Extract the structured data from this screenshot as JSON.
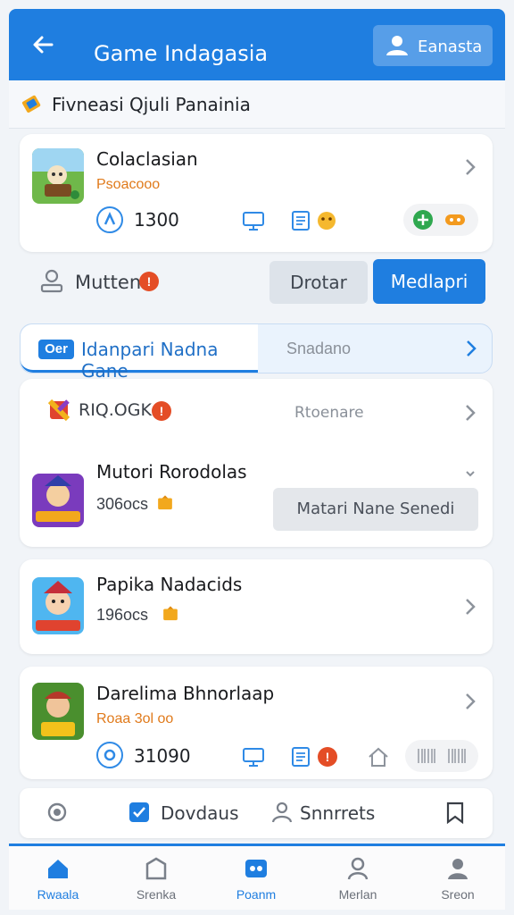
{
  "header": {
    "title": "Game Indagasia",
    "profile_label": "Eanasta"
  },
  "subtitle": "Fivneasi Qjuli Panainia",
  "card1": {
    "title": "Colaclasian",
    "subtitle": "Psoacooo",
    "stat": "1300"
  },
  "action_row": {
    "user_label": "Mutten",
    "badge": "!",
    "secondary_button": "Drotar",
    "primary_button": "Medlapri"
  },
  "tabs": {
    "chip": "Oer",
    "active_label": "Idanpari Nadna Gane",
    "other_label": "Snadano"
  },
  "card2": {
    "header_label": "RIQ.OGK",
    "header_badge": "!",
    "header_right": "Rtoenare",
    "game_title": "Mutori Rorodolas",
    "game_sub": "306ocs",
    "button": "Matari Nane Senedi"
  },
  "card3": {
    "title": "Papika Nadacids",
    "sub": "196ocs"
  },
  "card4": {
    "title": "Darelima Bhnorlaap",
    "sub": "Roaa 3ol oo",
    "stat": "31090",
    "badge": "!"
  },
  "bottom_bar": {
    "item1_label": "Dovdaus",
    "item2_label": "Snnrrets"
  },
  "nav": [
    {
      "label": "Rwaala",
      "icon": "home-icon"
    },
    {
      "label": "Srenka",
      "icon": "shop-icon"
    },
    {
      "label": "Poanm",
      "icon": "gamepad-icon"
    },
    {
      "label": "Merlan",
      "icon": "person-icon"
    },
    {
      "label": "Sreon",
      "icon": "profile-icon"
    }
  ],
  "colors": {
    "brand": "#1f7ee0",
    "accent_orange": "#e07a1b",
    "badge_red": "#e44d26"
  }
}
